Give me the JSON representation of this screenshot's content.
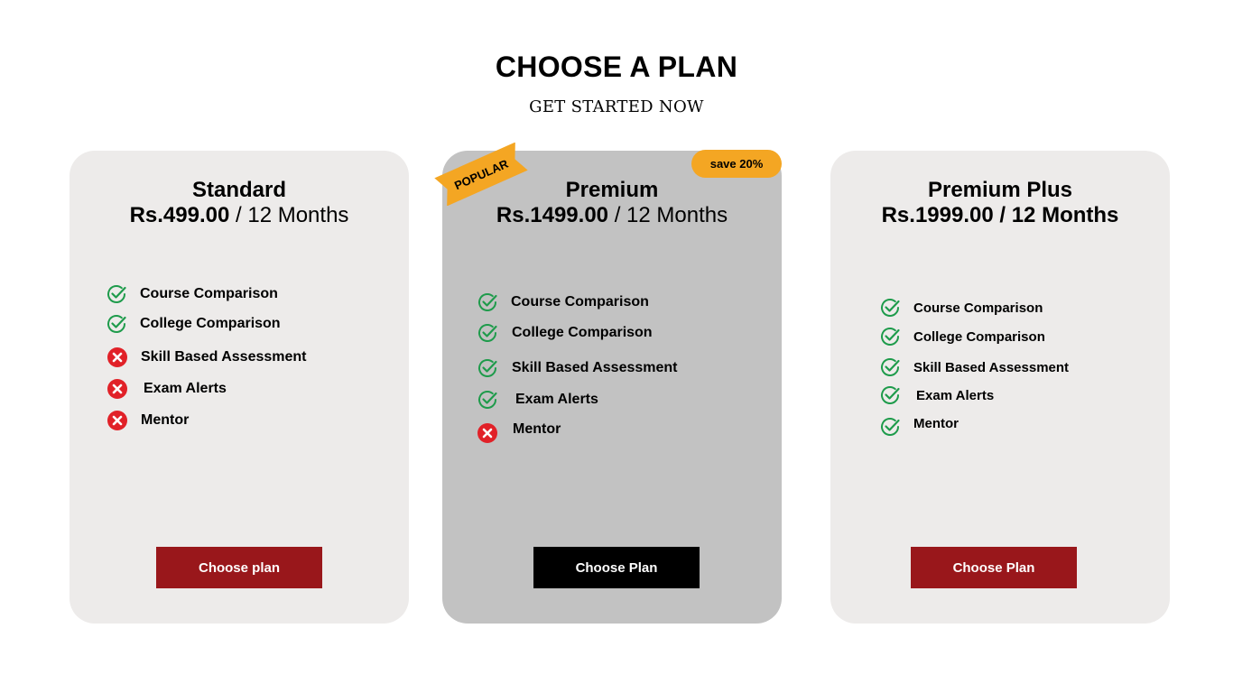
{
  "header": {
    "title": "CHOOSE A PLAN",
    "subtitle": "GET STARTED NOW"
  },
  "colors": {
    "check": "#1e9b4b",
    "cross": "#e12128",
    "accent_red": "#99171b",
    "badge": "#f4a623"
  },
  "plans": [
    {
      "name": "Standard",
      "price": "Rs.499.00",
      "period": "/ 12 Months",
      "features": [
        {
          "label": "Course Comparison",
          "icon": "check-icon"
        },
        {
          "label": "College Comparison",
          "icon": "check-icon"
        },
        {
          "label": "Skill Based Assessment",
          "icon": "cross-icon"
        },
        {
          "label": "Exam Alerts",
          "icon": "cross-icon"
        },
        {
          "label": "Mentor",
          "icon": "cross-icon"
        }
      ],
      "button": "Choose plan"
    },
    {
      "name": "Premium",
      "price": "Rs.1499.00",
      "period": "/ 12 Months",
      "ribbon": "POPULAR",
      "badge": "save 20%",
      "features": [
        {
          "label": "Course Comparison",
          "icon": "check-icon"
        },
        {
          "label": "College Comparison",
          "icon": "check-icon"
        },
        {
          "label": "Skill Based Assessment",
          "icon": "check-icon"
        },
        {
          "label": "Exam Alerts",
          "icon": "check-icon"
        },
        {
          "label": "Mentor",
          "icon": "cross-icon"
        }
      ],
      "button": "Choose Plan"
    },
    {
      "name": "Premium Plus",
      "price": "Rs.1999.00",
      "period": "/ 12 Months",
      "features": [
        {
          "label": "Course Comparison",
          "icon": "check-icon"
        },
        {
          "label": "College Comparison",
          "icon": "check-icon"
        },
        {
          "label": "Skill Based Assessment",
          "icon": "check-icon"
        },
        {
          "label": "Exam Alerts",
          "icon": "check-icon"
        },
        {
          "label": "Mentor",
          "icon": "check-icon"
        }
      ],
      "button": "Choose Plan"
    }
  ]
}
